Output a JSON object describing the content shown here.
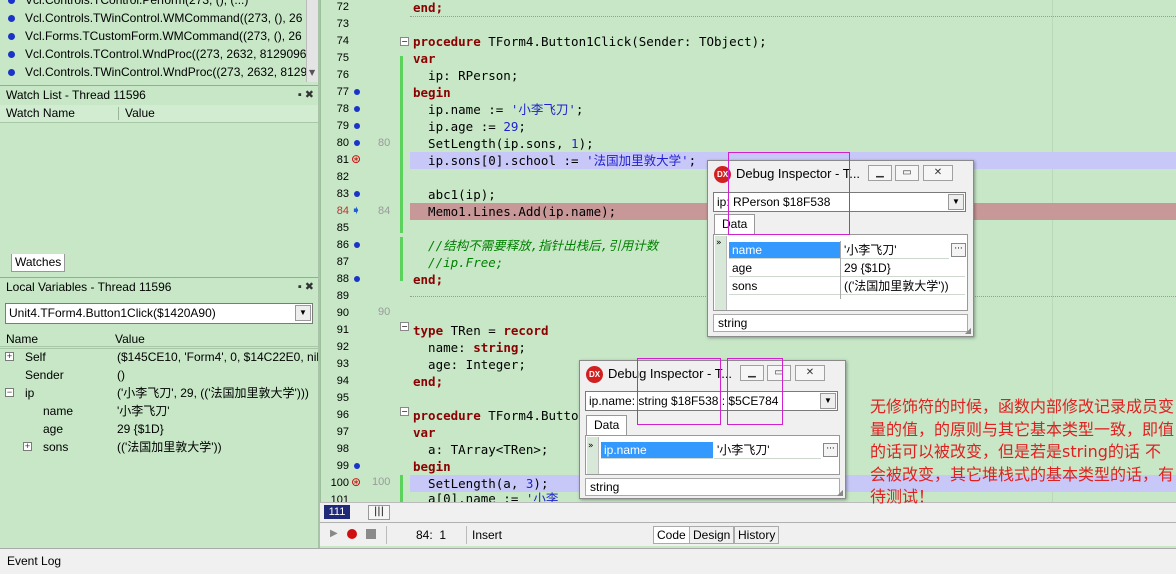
{
  "call_stack": {
    "items": [
      "Vcl.Controls.TControl.Perform(273, (), (...)",
      "Vcl.Controls.TWinControl.WMCommand((273, (), 26",
      "Vcl.Forms.TCustomForm.WMCommand((273, (), 26",
      "Vcl.Controls.TControl.WndProc((273, 2632, 8129096,",
      "Vcl.Controls.TWinControl.WndProc((273, 2632, 8129"
    ]
  },
  "watch_list": {
    "title": "Watch List - Thread 11596",
    "col_name": "Watch Name",
    "col_value": "Value",
    "tab": "Watches"
  },
  "local_vars": {
    "title": "Local Variables - Thread 11596",
    "scope": "Unit4.TForm4.Button1Click($1420A90)",
    "col_name": "Name",
    "col_value": "Value",
    "rows": [
      {
        "name": "Self",
        "value": "($145CE10, 'Form4', 0, $14C22E0, nil,..."
      },
      {
        "name": "Sender",
        "value": "()"
      },
      {
        "name": "ip",
        "value": "('小李飞刀', 29, (('法国加里敦大学')))"
      },
      {
        "name": "name",
        "value": "'小李飞刀'"
      },
      {
        "name": "age",
        "value": "29 {$1D}"
      },
      {
        "name": "sons",
        "value": "(('法国加里敦大学'))"
      }
    ]
  },
  "editor": {
    "line_numbers": [
      "72",
      "73",
      "74",
      "75",
      "76",
      "77",
      "78",
      "79",
      "80",
      "81",
      "82",
      "83",
      "84",
      "85",
      "86",
      "87",
      "88",
      "89",
      "90",
      "91",
      "92",
      "93",
      "94",
      "95",
      "96",
      "97",
      "98",
      "99",
      "100",
      "101"
    ],
    "gutter_marks": {
      "l80": "80",
      "l84": "84",
      "l90": "90",
      "l100": "100"
    },
    "current_line_box": "111",
    "code": {
      "c72": "end;",
      "c74_kw": "procedure",
      "c74_rest": " TForm4.Button1Click(Sender: TObject);",
      "c75": "var",
      "c76": "  ip: RPerson;",
      "c77": "begin",
      "c78_a": "  ip.name := ",
      "c78_s": "'小李飞刀'",
      "c78_b": ";",
      "c79_a": "  ip.age := ",
      "c79_n": "29",
      "c79_b": ";",
      "c80_a": "  SetLength(ip.sons, ",
      "c80_n": "1",
      "c80_b": ");",
      "c81_a": "  ip.sons[0].school := ",
      "c81_s": "'法国加里敦大学'",
      "c81_b": ";",
      "c83": "  abc1(ip);",
      "c84": "  Memo1.Lines.Add(ip.name);",
      "c86": "  //结构不需要释放,指针出栈后,引用计数",
      "c87": "  //ip.Free;",
      "c88": "end;",
      "c91_kw": "type",
      "c91_a": " TRen = ",
      "c91_kw2": "record",
      "c92_a": "  name: ",
      "c92_kw": "string",
      "c92_b": ";",
      "c93": "  age: Integer;",
      "c94": "end;",
      "c96_kw": "procedure",
      "c96_rest": " TForm4.Butto",
      "c97": "var",
      "c98": "  a: TArray<TRen>;",
      "c99": "begin",
      "c100_a": "  SetLength(a, ",
      "c100_n": "3",
      "c100_b": ");",
      "c101_a": "  a[0].name := ",
      "c101_s": "'小李"
    }
  },
  "inspector1": {
    "title": "Debug Inspector - T...",
    "combo": "ip: RPerson $18F538",
    "tab": "Data",
    "rows": [
      {
        "field": "name",
        "value": "'小李飞刀'"
      },
      {
        "field": "age",
        "value": "29 {$1D}"
      },
      {
        "field": "sons",
        "value": "(('法国加里敦大学'))"
      }
    ],
    "status": "string"
  },
  "inspector2": {
    "title": "Debug Inspector - T...",
    "combo": "ip.name: string $18F538 : $5CE784",
    "tab": "Data",
    "rows": [
      {
        "field": "ip.name",
        "value": "'小李飞刀'"
      }
    ],
    "status": "string"
  },
  "editor_status": {
    "position": "84:  1",
    "mode": "Insert",
    "tabs": [
      "Code",
      "Design",
      "History"
    ]
  },
  "event_log": "Event Log",
  "note": "无修饰符的时候，函数内部修改记录成员变量的值，的原则与其它基本类型一致，即值的话可以被改变，但是若是string的话 不会被改变，其它堆栈式的基本类型的话，有待测试！",
  "colors": {
    "background": "#c7e7c7",
    "exec_point_line": "#c89898",
    "breakpoint_line": "#c8c8f8",
    "note_text": "#e02020",
    "selection": "#3399ff"
  }
}
